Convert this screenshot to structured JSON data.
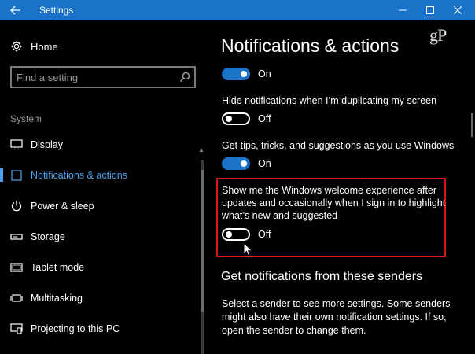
{
  "window": {
    "title": "Settings",
    "back_icon": "arrow-left-icon",
    "controls": [
      "minimize-icon",
      "maximize-icon",
      "close-icon"
    ],
    "accent_color": "#1a73c8"
  },
  "sidebar": {
    "home": {
      "label": "Home",
      "icon": "gear-icon"
    },
    "search": {
      "placeholder": "Find a setting",
      "value": "",
      "icon": "search-icon"
    },
    "section_label": "System",
    "items": [
      {
        "label": "Display",
        "icon": "monitor-icon",
        "active": false
      },
      {
        "label": "Notifications & actions",
        "icon": "notification-icon",
        "active": true
      },
      {
        "label": "Power & sleep",
        "icon": "power-icon",
        "active": false
      },
      {
        "label": "Storage",
        "icon": "storage-icon",
        "active": false
      },
      {
        "label": "Tablet mode",
        "icon": "tablet-icon",
        "active": false
      },
      {
        "label": "Multitasking",
        "icon": "multitasking-icon",
        "active": false
      },
      {
        "label": "Projecting to this PC",
        "icon": "projecting-icon",
        "active": false
      }
    ]
  },
  "main": {
    "title": "Notifications & actions",
    "logo_text": "gP",
    "settings": [
      {
        "label": "",
        "state": "On",
        "on": true
      },
      {
        "label": "Hide notifications when I’m duplicating my screen",
        "state": "Off",
        "on": false
      },
      {
        "label": "Get tips, tricks, and suggestions as you use Windows",
        "state": "On",
        "on": true
      },
      {
        "label": "Show me the Windows welcome experience after updates and occasionally when I sign in to highlight what’s new and suggested",
        "state": "Off",
        "on": false,
        "highlighted": true
      }
    ],
    "senders_heading": "Get notifications from these senders",
    "senders_description": "Select a sender to see more settings. Some senders might also have their own notification settings. If so, open the sender to change them.",
    "highlight_color": "#d01a1a"
  }
}
